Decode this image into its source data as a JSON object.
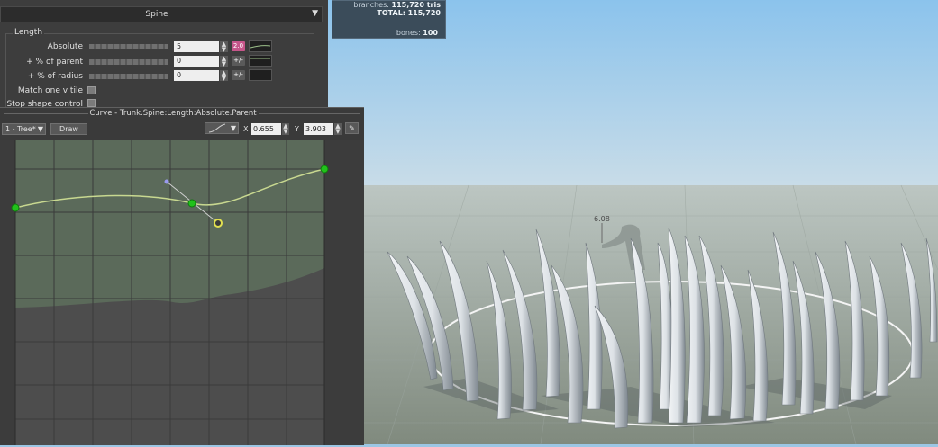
{
  "stats": {
    "branches_label": "branches:",
    "branches_value": "115,720 tris",
    "total_label": "TOTAL:",
    "total_value": "115,720",
    "bones_label": "bones:",
    "bones_value": "100"
  },
  "viewport": {
    "ruler_label": "6.08"
  },
  "property_panel": {
    "header_title": "Spine",
    "group_title": "Length",
    "rows": [
      {
        "label": "Absolute",
        "value": "5",
        "button": "2.0"
      },
      {
        "label": "+ % of parent",
        "value": "0",
        "button": "+/-"
      },
      {
        "label": "+ % of radius",
        "value": "0",
        "button": "+/-"
      }
    ],
    "checkboxes": [
      {
        "label": "Match one v tile"
      },
      {
        "label": "Stop shape control"
      }
    ]
  },
  "curve_editor": {
    "title": "Curve - Trunk.Spine:Length:Absolute.Parent",
    "preset": "1 - Tree*",
    "draw_label": "Draw",
    "x_label": "X",
    "x_value": "0.655",
    "y_label": "Y",
    "y_value": "3.903"
  },
  "colors": {
    "curve_line": "#c8d890",
    "control_point": "#21c21b",
    "selected_point": "#e2e050",
    "handle_point": "#9a9af0",
    "curve_area": "#5b6a5a",
    "button_pink": "#c6568a",
    "button_grey": "#5a5a5a"
  }
}
